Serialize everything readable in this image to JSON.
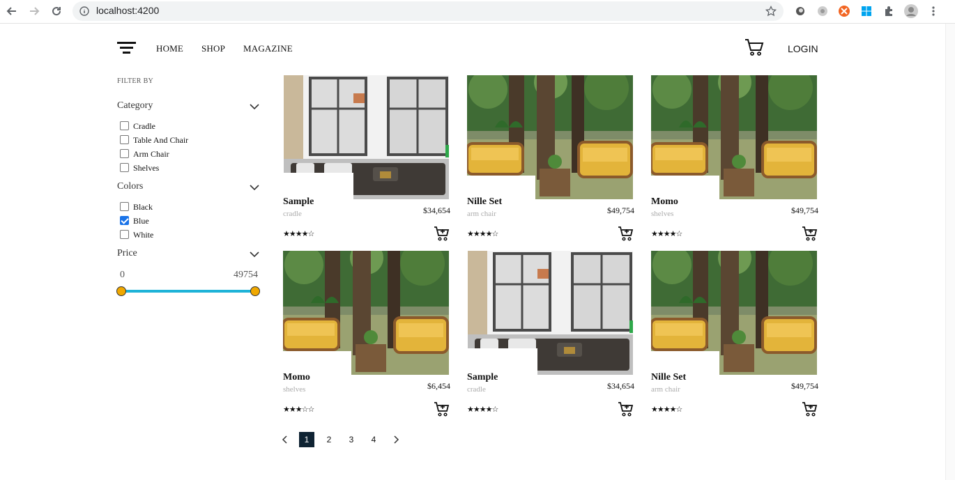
{
  "browser": {
    "url": "localhost:4200"
  },
  "header": {
    "menu": [
      "HOME",
      "SHOP",
      "MAGAZINE"
    ],
    "login": "LOGIN"
  },
  "sidebar": {
    "filter_by": "FILTER BY",
    "category": {
      "title": "Category",
      "options": [
        {
          "label": "Cradle",
          "checked": false
        },
        {
          "label": "Table And Chair",
          "checked": false
        },
        {
          "label": "Arm Chair",
          "checked": false
        },
        {
          "label": "Shelves",
          "checked": false
        }
      ]
    },
    "colors": {
      "title": "Colors",
      "options": [
        {
          "label": "Black",
          "checked": false
        },
        {
          "label": "Blue",
          "checked": true
        },
        {
          "label": "White",
          "checked": false
        }
      ]
    },
    "price": {
      "title": "Price",
      "min": "0",
      "max": "49754"
    }
  },
  "products": [
    {
      "name": "Sample",
      "category": "cradle",
      "price": "$34,654",
      "stars": "★★★★☆",
      "rating": 4,
      "image": "window-sofa"
    },
    {
      "name": "Nille Set",
      "category": "arm chair",
      "price": "$49,754",
      "stars": "★★★★☆",
      "rating": 4,
      "image": "yellow-chairs"
    },
    {
      "name": "Momo",
      "category": "shelves",
      "price": "$49,754",
      "stars": "★★★★☆",
      "rating": 4,
      "image": "yellow-chairs"
    },
    {
      "name": "Momo",
      "category": "shelves",
      "price": "$6,454",
      "stars": "★★★☆☆",
      "rating": 3,
      "image": "yellow-chairs"
    },
    {
      "name": "Sample",
      "category": "cradle",
      "price": "$34,654",
      "stars": "★★★★☆",
      "rating": 4,
      "image": "window-sofa"
    },
    {
      "name": "Nille Set",
      "category": "arm chair",
      "price": "$49,754",
      "stars": "★★★★☆",
      "rating": 4,
      "image": "yellow-chairs"
    }
  ],
  "pagination": {
    "prev": "‹",
    "pages": [
      "1",
      "2",
      "3",
      "4"
    ],
    "active": "1",
    "next": "›"
  },
  "colors": {
    "slider": "#1eb3d8",
    "thumb": "#f0a800",
    "active_page": "#0f2333",
    "checkbox": "#1a73e8"
  }
}
